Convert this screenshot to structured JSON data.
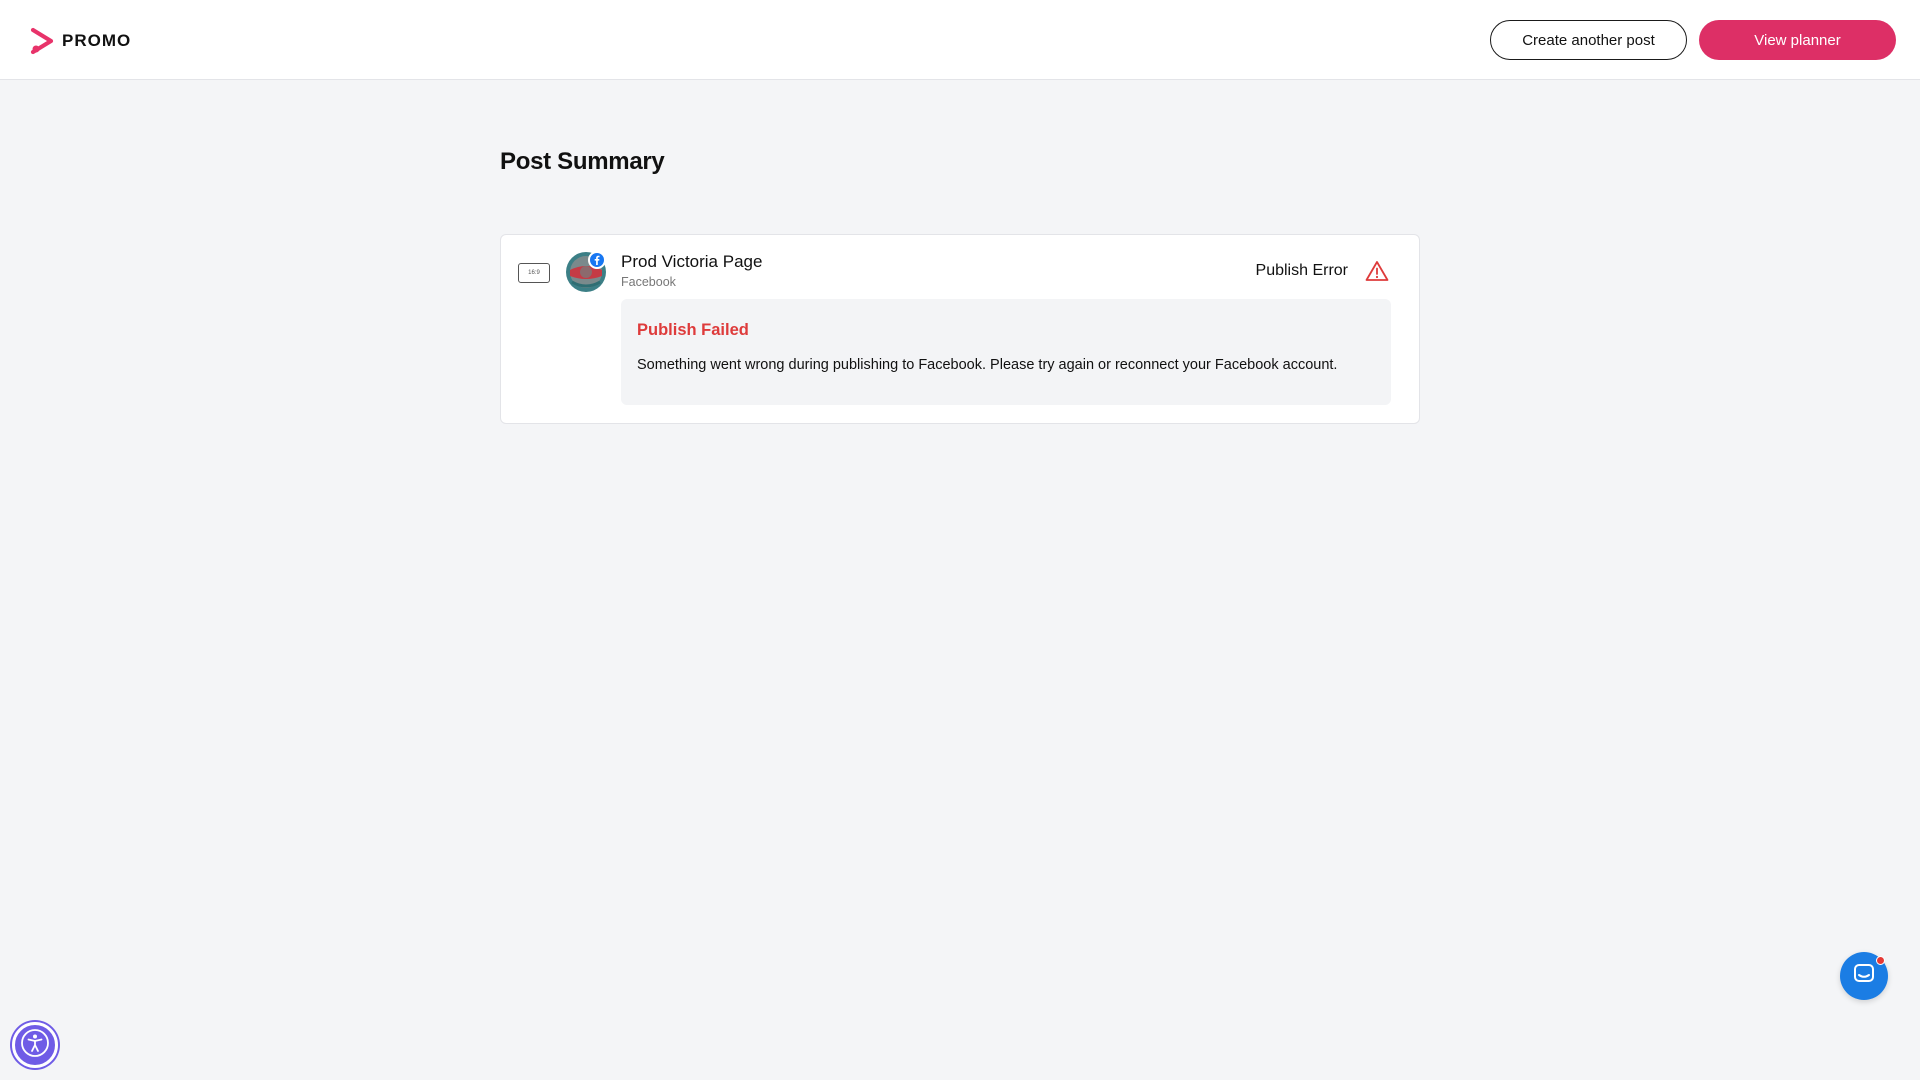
{
  "header": {
    "logo_text": "PROMO",
    "create_button_label": "Create another post",
    "planner_button_label": "View planner"
  },
  "main": {
    "title": "Post Summary",
    "post": {
      "aspect_ratio": "16:9",
      "page_name": "Prod Victoria Page",
      "network": "Facebook",
      "status": "Publish Error",
      "error": {
        "title": "Publish Failed",
        "message": "Something went wrong during publishing to Facebook. Please try again or reconnect your Facebook account."
      }
    }
  },
  "colors": {
    "brand": "#dd2f66",
    "error": "#de3b3b",
    "facebook": "#1877f2",
    "chat": "#1b7de4",
    "accessibility": "#6f5ce6"
  },
  "icons": [
    "promo-logo-icon",
    "aspect-ratio-icon",
    "facebook-badge-icon",
    "warning-icon",
    "chat-icon",
    "accessibility-icon"
  ]
}
